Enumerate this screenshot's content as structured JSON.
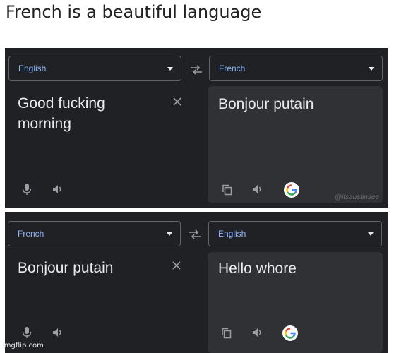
{
  "meme": {
    "title": "French is a beautiful language"
  },
  "panel1": {
    "source_lang": "English",
    "target_lang": "French",
    "source_text_lines": [
      "Good fucking",
      "morning"
    ],
    "target_text": "Bonjour putain",
    "watermark": "@itsaustinsee"
  },
  "panel2": {
    "source_lang": "French",
    "target_lang": "English",
    "source_text": "Bonjour putain",
    "target_text": "Hello whore"
  },
  "footer": {
    "imgflip": "imgflip.com"
  },
  "colors": {
    "panel_bg": "#202124",
    "target_bg": "#303134",
    "accent": "#8ab4f8",
    "text": "#e8eaed",
    "icon": "#9aa0a6"
  },
  "icons": [
    "swap-icon",
    "close-icon",
    "mic-icon",
    "speaker-icon",
    "copy-icon",
    "google-icon",
    "chevron-down-icon"
  ]
}
